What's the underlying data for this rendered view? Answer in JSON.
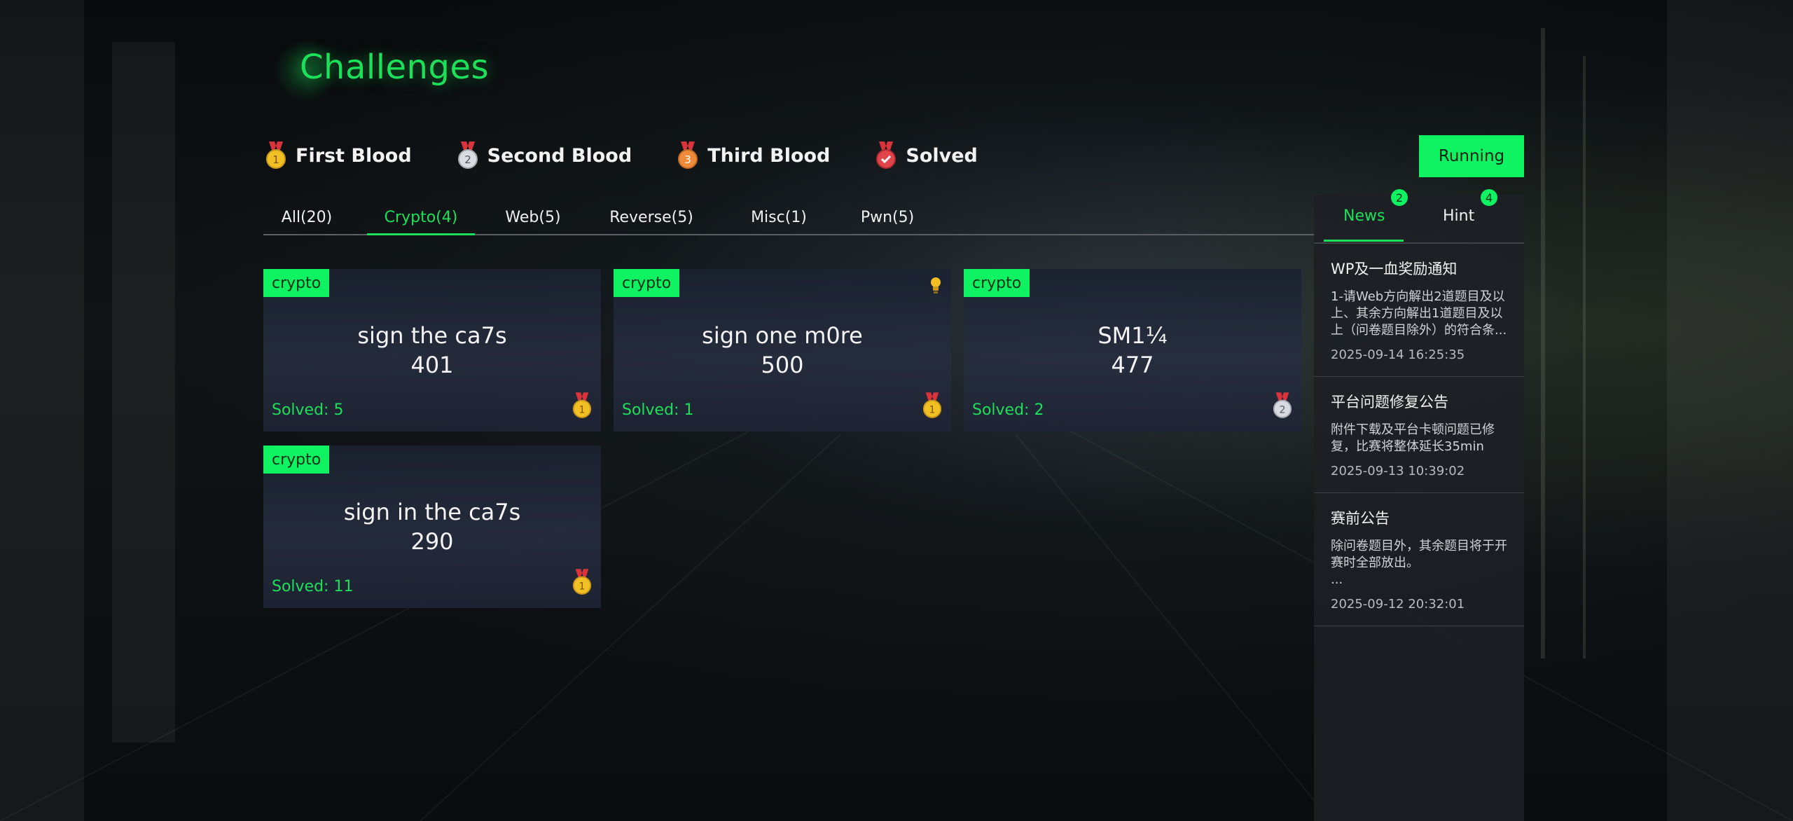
{
  "page": {
    "title": "Challenges"
  },
  "legend": [
    {
      "label": "First Blood",
      "medal": "gold-medal-1"
    },
    {
      "label": "Second Blood",
      "medal": "silver-medal-2"
    },
    {
      "label": "Third Blood",
      "medal": "bronze-medal-3"
    },
    {
      "label": "Solved",
      "medal": "red-check-medal"
    }
  ],
  "status_button": {
    "label": "Running"
  },
  "tabs": [
    {
      "label": "All(20)",
      "active": false
    },
    {
      "label": "Crypto(4)",
      "active": true
    },
    {
      "label": "Web(5)",
      "active": false
    },
    {
      "label": "Reverse(5)",
      "active": false
    },
    {
      "label": "Misc(1)",
      "active": false
    },
    {
      "label": "Pwn(5)",
      "active": false
    }
  ],
  "challenges": [
    {
      "tag": "crypto",
      "name": "sign the ca7s",
      "score": "401",
      "solved": "Solved: 5",
      "medal": "gold-medal-1",
      "medal_num": "1",
      "hint_icon": false
    },
    {
      "tag": "crypto",
      "name": "sign one m0re",
      "score": "500",
      "solved": "Solved: 1",
      "medal": "gold-medal-1",
      "medal_num": "1",
      "hint_icon": true
    },
    {
      "tag": "crypto",
      "name": "SM1¼",
      "score": "477",
      "solved": "Solved: 2",
      "medal": "silver-medal-2",
      "medal_num": "2",
      "hint_icon": false
    },
    {
      "tag": "crypto",
      "name": "sign in the ca7s",
      "score": "290",
      "solved": "Solved: 11",
      "medal": "gold-medal-1",
      "medal_num": "1",
      "hint_icon": false
    }
  ],
  "panel": {
    "tabs": [
      {
        "label": "News",
        "badge": "2",
        "active": true
      },
      {
        "label": "Hint",
        "badge": "4",
        "active": false
      }
    ],
    "news": [
      {
        "title": "WP及一血奖励通知",
        "body": "1-请Web方向解出2道题目及以上、其余方向解出1道题目及以上（问卷题目除外）的符合条...",
        "date": "2025-09-14 16:25:35"
      },
      {
        "title": "平台问题修复公告",
        "body": "附件下载及平台卡顿问题已修复，比赛将整体延长35min",
        "date": "2025-09-13 10:39:02"
      },
      {
        "title": "赛前公告",
        "body": "除问卷题目外，其余题目将于开赛时全部放出。\n...",
        "date": "2025-09-12 20:32:01"
      }
    ]
  },
  "colors": {
    "accent": "#0ff261",
    "accent_text": "#1de05a",
    "gold": "#f2c024",
    "silver": "#d8dce0",
    "bronze": "#ee8a3a",
    "ribbon": "#d9333b"
  }
}
